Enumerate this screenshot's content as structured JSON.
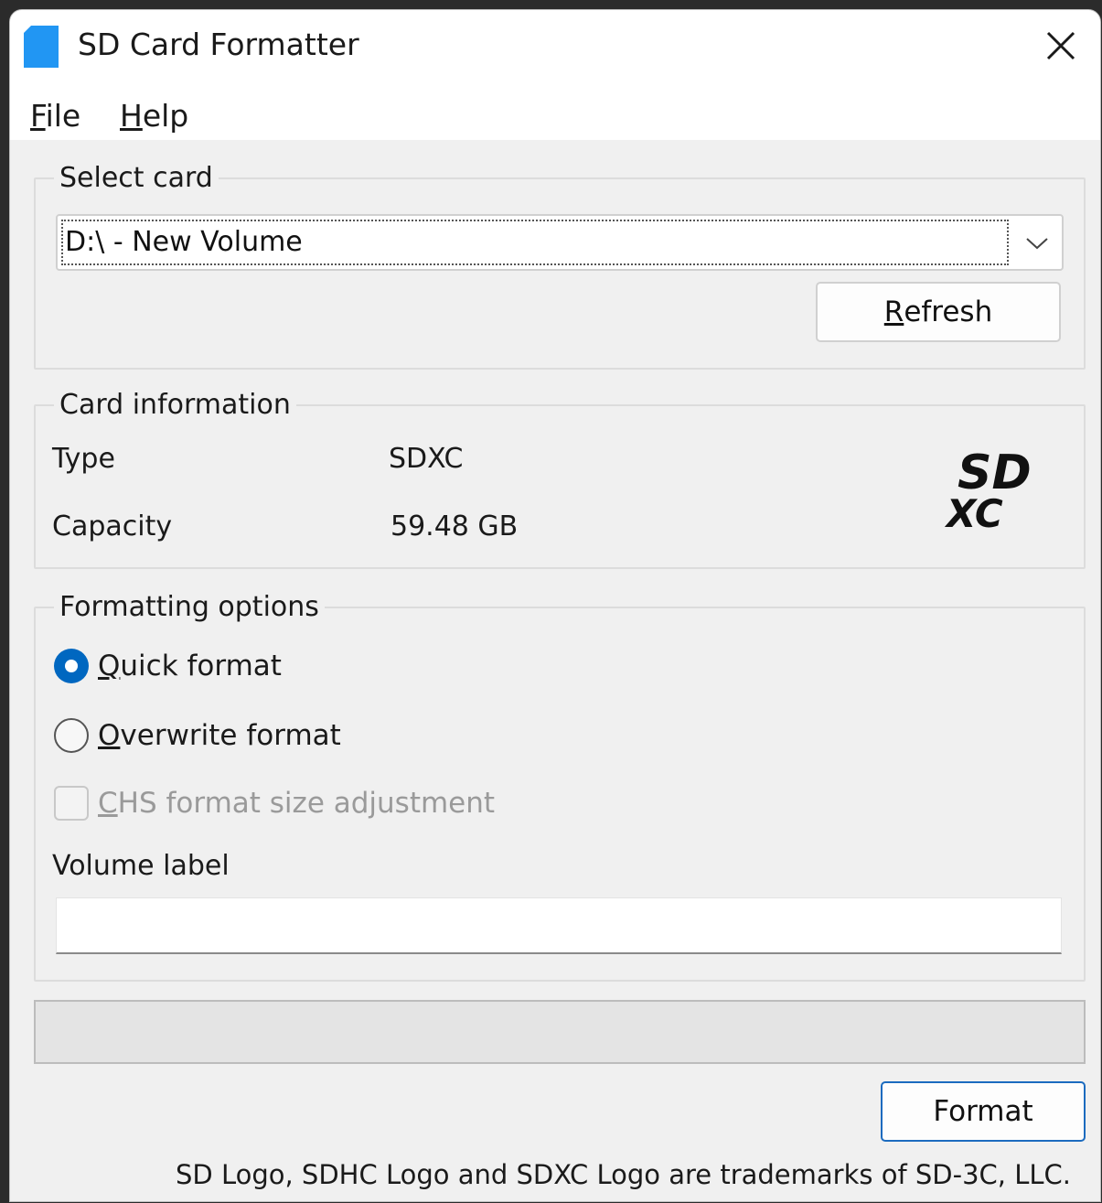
{
  "window": {
    "title": "SD Card Formatter"
  },
  "menu": {
    "file_mnemonic": "F",
    "file_rest": "ile",
    "help_mnemonic": "H",
    "help_rest": "elp"
  },
  "select_card": {
    "legend": "Select card",
    "selected_value": "D:\\ - New Volume",
    "refresh_mnemonic": "R",
    "refresh_rest": "efresh"
  },
  "card_info": {
    "legend": "Card information",
    "type_label": "Type",
    "type_value": "SDXC",
    "capacity_label": "Capacity",
    "capacity_value": "59.48 GB",
    "logo_text_top": "SD",
    "logo_text_bottom": "XC"
  },
  "format_options": {
    "legend": "Formatting options",
    "quick_mnemonic": "Q",
    "quick_rest": "uick format",
    "quick_selected": true,
    "overwrite_mnemonic": "O",
    "overwrite_rest": "verwrite format",
    "chs_mnemonic": "C",
    "chs_rest": "HS format size adjustment",
    "chs_checked": false,
    "chs_enabled": false,
    "volume_label": "Volume label",
    "volume_value": ""
  },
  "progress": {
    "fraction": 0
  },
  "actions": {
    "format_label": "Format"
  },
  "footer": {
    "trademark": "SD Logo, SDHC Logo and SDXC Logo are trademarks of SD-3C, LLC."
  },
  "colors": {
    "accent": "#0067c0",
    "window_bg": "#f0f0f0",
    "title_bg": "#ffffff",
    "app_icon": "#2196f3"
  }
}
